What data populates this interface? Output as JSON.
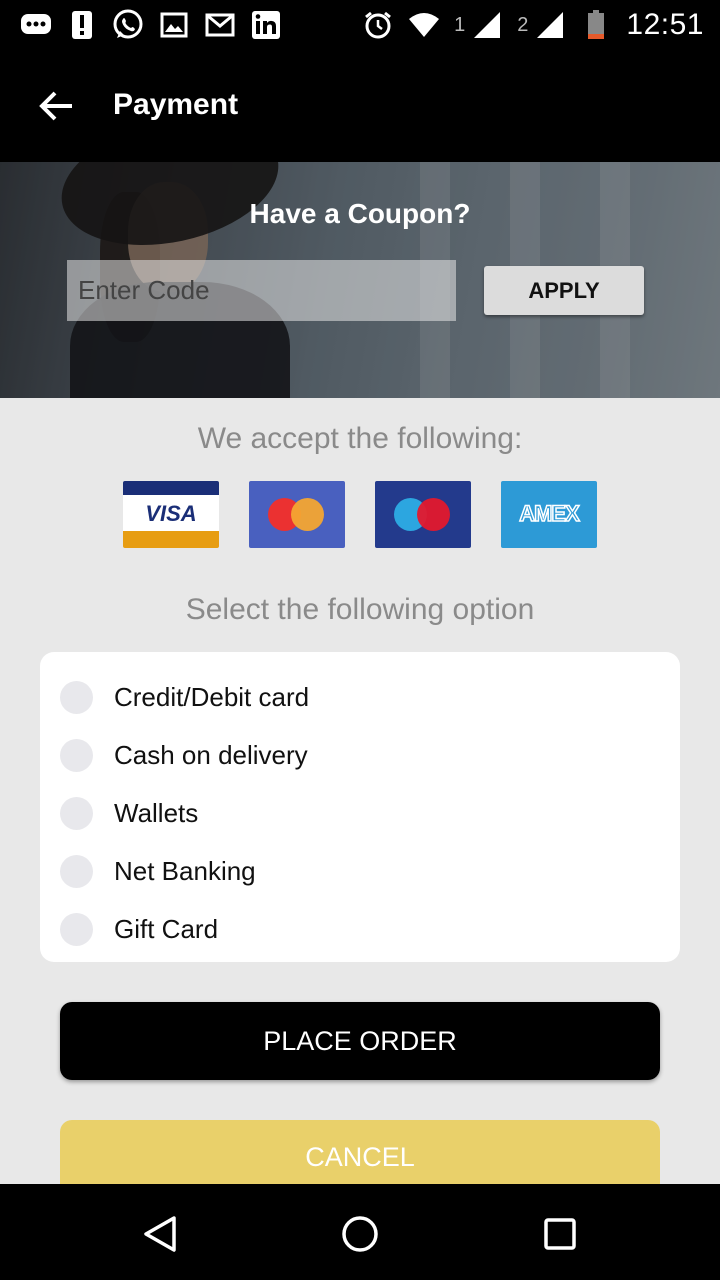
{
  "status_bar": {
    "time": "12:51",
    "sim1_label": "1",
    "sim2_label": "2",
    "icons": [
      "chat-bubble-icon",
      "alert-icon",
      "whatsapp-icon",
      "image-icon",
      "gmail-icon",
      "linkedin-icon",
      "alarm-icon",
      "wifi-icon",
      "signal-icon",
      "signal-icon",
      "battery-low-icon"
    ]
  },
  "app_bar": {
    "title": "Payment",
    "back_icon": "arrow-left-icon"
  },
  "coupon": {
    "title": "Have a Coupon?",
    "input_placeholder": "Enter Code",
    "input_value": "",
    "apply_label": "APPLY"
  },
  "accept": {
    "title": "We accept the following:",
    "cards": [
      {
        "name": "visa",
        "label": "VISA",
        "colors": [
          "#1a2e77",
          "#e79d12"
        ]
      },
      {
        "name": "mastercard",
        "colors": [
          "#4960bf",
          "#eb3131",
          "#f4a531"
        ]
      },
      {
        "name": "maestro",
        "colors": [
          "#233a8c",
          "#2ca6e0",
          "#e3182d"
        ]
      },
      {
        "name": "amex",
        "label": "AMEX",
        "colors": [
          "#2d9ad6"
        ]
      }
    ]
  },
  "payment_options": {
    "title": "Select the following option",
    "options": [
      "Credit/Debit card",
      "Cash on delivery",
      "Wallets",
      "Net Banking",
      "Gift Card"
    ],
    "selected": null
  },
  "actions": {
    "place_order_label": "PLACE ORDER",
    "cancel_label": "CANCEL"
  },
  "colors": {
    "primary": "#000000",
    "cancel": "#e9d06a",
    "background": "#e8e8e8",
    "muted_text": "#8a8a8a"
  },
  "nav_bar": {
    "icons": [
      "back-triangle-icon",
      "home-circle-icon",
      "recents-square-icon"
    ]
  }
}
